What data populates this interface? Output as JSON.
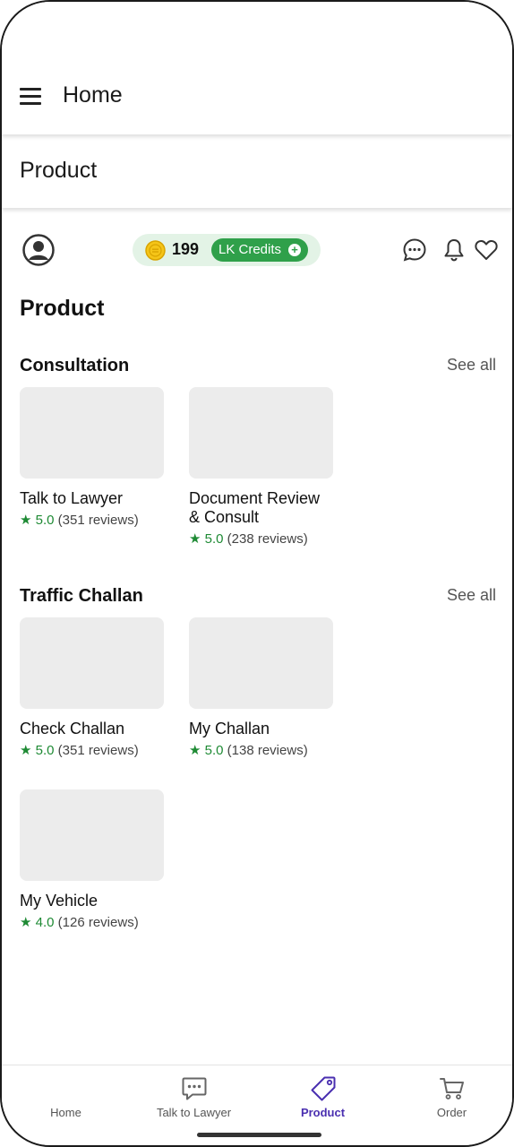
{
  "appbar": {
    "title": "Home"
  },
  "subbar": {
    "title": "Product"
  },
  "credits": {
    "count": "199",
    "label": "LK Credits",
    "plus": "+"
  },
  "page": {
    "heading": "Product"
  },
  "sections": [
    {
      "title": "Consultation",
      "see_all": "See all",
      "items": [
        {
          "name": "Talk to Lawyer",
          "rating": "5.0",
          "reviews": "(351 reviews)"
        },
        {
          "name": "Document Review & Consult",
          "rating": "5.0",
          "reviews": "(238 reviews)"
        }
      ]
    },
    {
      "title": "Traffic Challan",
      "see_all": "See all",
      "items": [
        {
          "name": "Check Challan",
          "rating": "5.0",
          "reviews": "(351 reviews)"
        },
        {
          "name": "My Challan",
          "rating": "5.0",
          "reviews": "(138 reviews)"
        },
        {
          "name": "My Vehicle",
          "rating": "4.0",
          "reviews": "(126 reviews)"
        }
      ]
    }
  ],
  "star_glyph": "★",
  "bottom_nav": [
    {
      "label": "Home",
      "icon": "home-icon"
    },
    {
      "label": "Talk to Lawyer",
      "icon": "chat-icon"
    },
    {
      "label": "Product",
      "icon": "tag-icon",
      "active": true
    },
    {
      "label": "Order",
      "icon": "cart-icon"
    }
  ],
  "colors": {
    "accent": "#4a2fb0",
    "green": "#2fa04a",
    "rating": "#1e8a34"
  }
}
